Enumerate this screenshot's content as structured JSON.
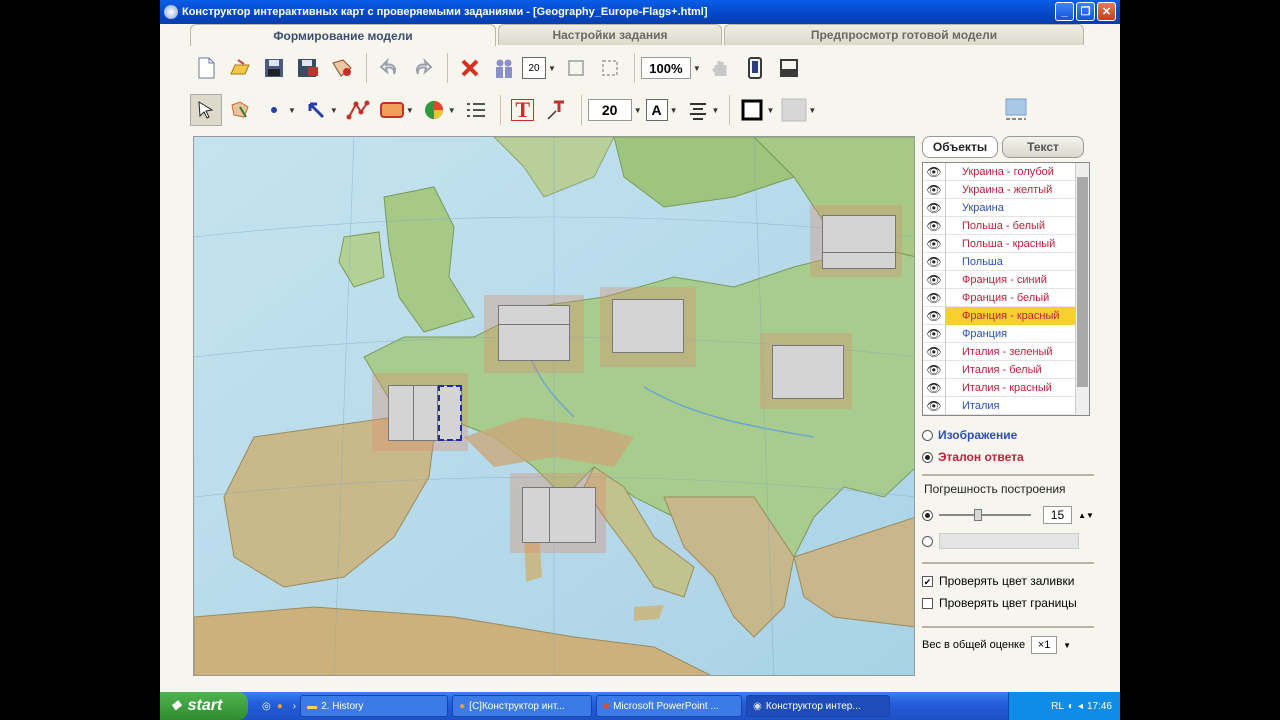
{
  "window": {
    "title": "Конструктор интерактивных карт с проверяемыми заданиями - [Geography_Europe-Flags+.html]"
  },
  "tabs": [
    {
      "label": "Формирование модели"
    },
    {
      "label": "Настройки задания"
    },
    {
      "label": "Предпросмотр готовой модели"
    }
  ],
  "toolbar1": {
    "frame_size": "20",
    "zoom": "100%"
  },
  "toolbar2": {
    "text_tool": "T",
    "font_size": "20",
    "font_style": "A"
  },
  "panel": {
    "tabs": [
      {
        "label": "Объекты"
      },
      {
        "label": "Текст"
      }
    ],
    "objects": [
      {
        "label": "Украина - голубой",
        "color": "#c0203a"
      },
      {
        "label": "Украина - желтый",
        "color": "#c0203a"
      },
      {
        "label": "Украина",
        "color": "#2d4fb8"
      },
      {
        "label": "Польша - белый",
        "color": "#c0203a"
      },
      {
        "label": "Польша - красный",
        "color": "#c0203a"
      },
      {
        "label": "Польша",
        "color": "#2d4fb8"
      },
      {
        "label": "Франция - синий",
        "color": "#c0203a"
      },
      {
        "label": "Франция - белый",
        "color": "#c0203a"
      },
      {
        "label": "Франция - красный",
        "color": "#c0203a",
        "selected": true
      },
      {
        "label": "Франция",
        "color": "#2d4fb8"
      },
      {
        "label": "Италия - зеленый",
        "color": "#c0203a"
      },
      {
        "label": "Италия - белый",
        "color": "#c0203a"
      },
      {
        "label": "Италия - красный",
        "color": "#c0203a"
      },
      {
        "label": "Италия",
        "color": "#2d4fb8"
      }
    ],
    "radio_image": "Изображение",
    "radio_answer": "Эталон ответа",
    "tolerance_label": "Погрешность построения",
    "tolerance_value": "15",
    "tolerance_level": 0.42,
    "check_fill": "Проверять цвет заливки",
    "check_border": "Проверять цвет границы",
    "weight_label": "Вес в общей оценке",
    "weight_value": "×1"
  },
  "taskbar": {
    "start": "start",
    "tasks": [
      {
        "label": "2. History"
      },
      {
        "label": "[C]Конструктор инт..."
      },
      {
        "label": "Microsoft PowerPoint ..."
      },
      {
        "label": "Конструктор интер..."
      }
    ],
    "lang": "RL",
    "clock": "17:46"
  }
}
